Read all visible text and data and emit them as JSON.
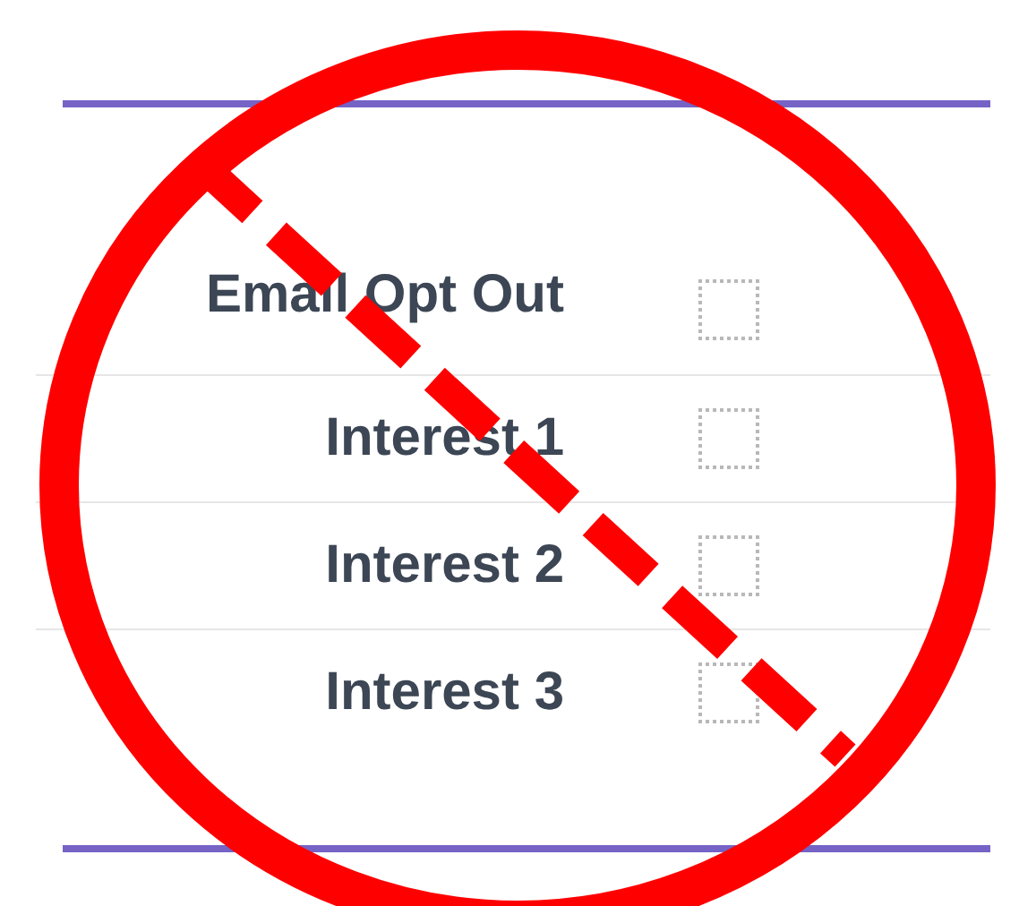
{
  "fields": [
    {
      "label": "Email Opt Out",
      "checked": false
    },
    {
      "label": "Interest 1",
      "checked": false
    },
    {
      "label": "Interest 2",
      "checked": false
    },
    {
      "label": "Interest 3",
      "checked": false
    }
  ],
  "annotation": {
    "kind": "prohibited"
  }
}
